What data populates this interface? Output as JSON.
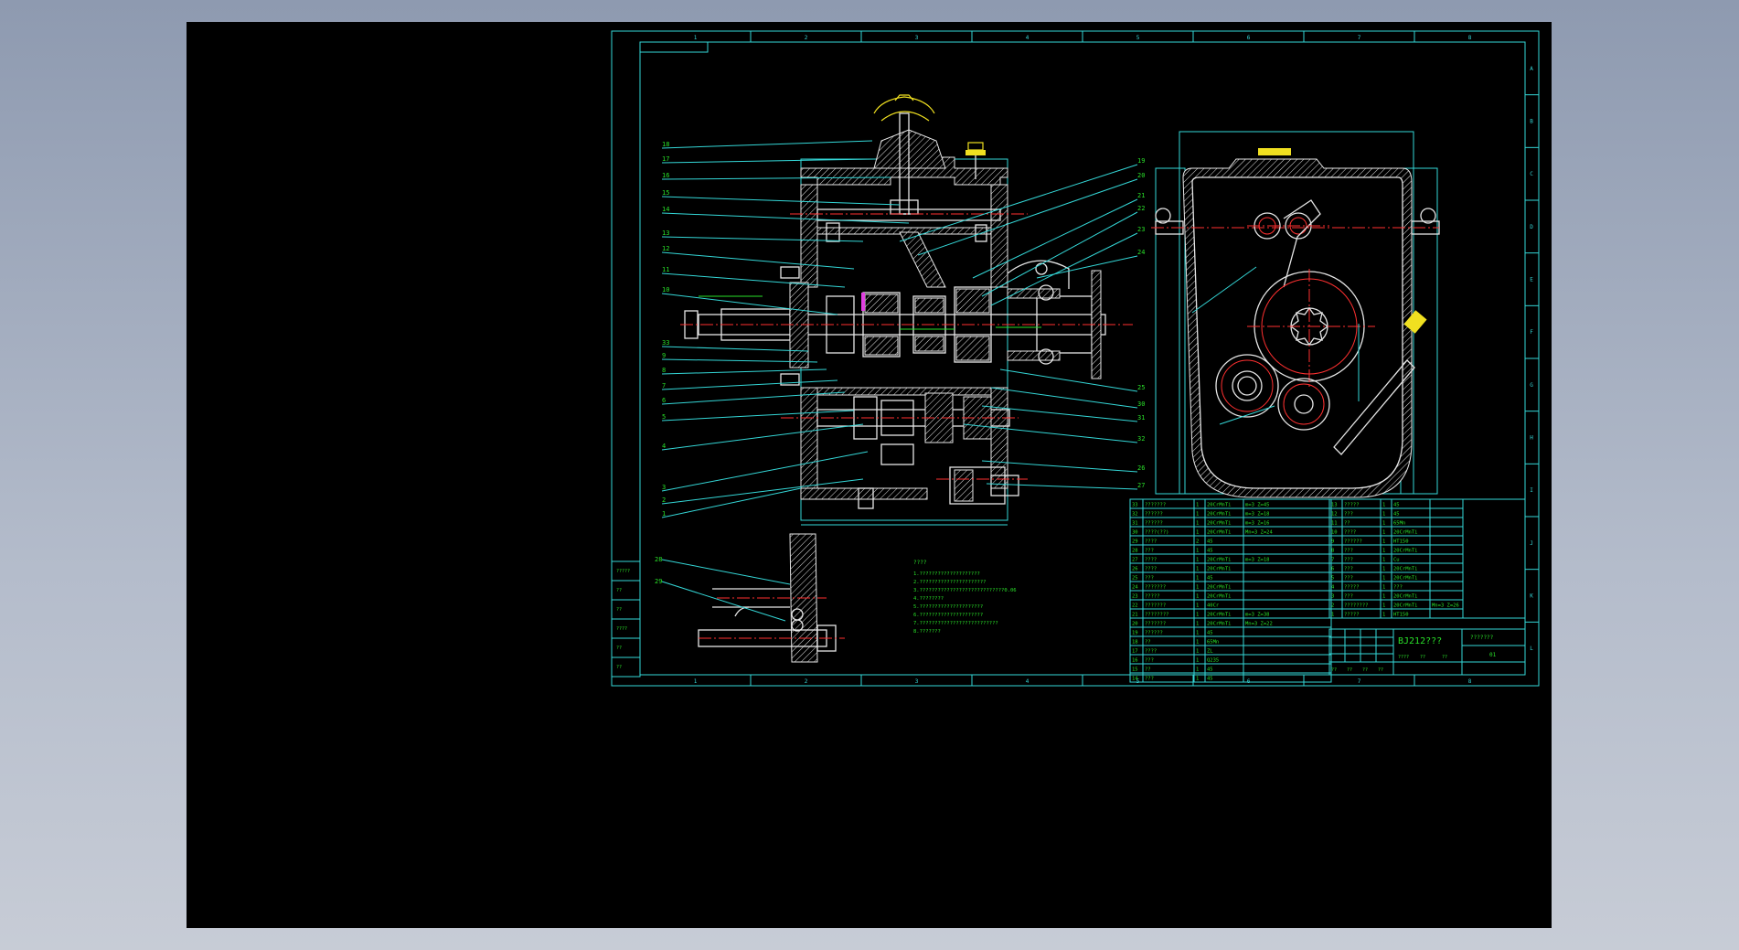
{
  "colors": {
    "background": "#000000",
    "border": "#34d7d7",
    "outline": "#e6e6e6",
    "text": "#29e029",
    "centerline": "#ff3030",
    "handle": "#f0e020"
  },
  "zone_columns": [
    "1",
    "2",
    "3",
    "4",
    "5",
    "6",
    "7",
    "8"
  ],
  "zone_rows": [
    "A",
    "B",
    "C",
    "D",
    "E",
    "F",
    "G",
    "H",
    "I",
    "J",
    "K",
    "L"
  ],
  "balloons_left": [
    "18",
    "17",
    "16",
    "15",
    "14",
    "13",
    "12",
    "11",
    "10",
    "33",
    "9",
    "8",
    "7",
    "6",
    "5",
    "4",
    "3",
    "2",
    "1"
  ],
  "balloons_right": [
    "19",
    "20",
    "21",
    "22",
    "23",
    "24",
    "25",
    "30",
    "31",
    "32",
    "26",
    "27"
  ],
  "detail_balloons": [
    "28",
    "29"
  ],
  "tech_requirements": {
    "heading": "????",
    "lines": [
      "1.????????????????????",
      "2.??????????????????????",
      "3.????????????????????????????0.06",
      "4.????????",
      "5.?????????????????????",
      "6.?????????????????????",
      "7.??????????????????????????",
      "8.???????"
    ]
  },
  "parts_left": [
    {
      "no": "33",
      "name": "???????",
      "qty": "1",
      "mat": "20CrMnTi",
      "note": "m=3 Z=45"
    },
    {
      "no": "32",
      "name": "??????",
      "qty": "1",
      "mat": "20CrMnTi",
      "note": "m=3 Z=18"
    },
    {
      "no": "31",
      "name": "??????",
      "qty": "1",
      "mat": "20CrMnTi",
      "note": "m=3 Z=16"
    },
    {
      "no": "30",
      "name": "????(??)",
      "qty": "1",
      "mat": "20CrMnTi",
      "note": "Mn=3 Z=24"
    },
    {
      "no": "29",
      "name": "????",
      "qty": "2",
      "mat": "45",
      "note": ""
    },
    {
      "no": "28",
      "name": "???",
      "qty": "1",
      "mat": "45",
      "note": ""
    },
    {
      "no": "27",
      "name": "????",
      "qty": "1",
      "mat": "20CrMnTi",
      "note": "m=3 Z=18"
    },
    {
      "no": "26",
      "name": "????",
      "qty": "1",
      "mat": "20CrMnTi",
      "note": ""
    },
    {
      "no": "25",
      "name": "???",
      "qty": "1",
      "mat": "45",
      "note": ""
    },
    {
      "no": "24",
      "name": "???????",
      "qty": "1",
      "mat": "20CrMnTi",
      "note": ""
    },
    {
      "no": "23",
      "name": "?????",
      "qty": "1",
      "mat": "20CrMnTi",
      "note": ""
    },
    {
      "no": "22",
      "name": "???????",
      "qty": "1",
      "mat": "40Cr",
      "note": ""
    },
    {
      "no": "21",
      "name": "????????",
      "qty": "1",
      "mat": "20CrMnTi",
      "note": "m=3 Z=38"
    },
    {
      "no": "20",
      "name": "???????",
      "qty": "1",
      "mat": "20CrMnTi",
      "note": "Mn=3 Z=22"
    },
    {
      "no": "19",
      "name": "??????",
      "qty": "1",
      "mat": "45",
      "note": ""
    },
    {
      "no": "18",
      "name": "??",
      "qty": "1",
      "mat": "65Mn",
      "note": ""
    },
    {
      "no": "17",
      "name": "????",
      "qty": "1",
      "mat": "ZL",
      "note": ""
    },
    {
      "no": "16",
      "name": "???",
      "qty": "1",
      "mat": "Q235",
      "note": ""
    },
    {
      "no": "15",
      "name": "??",
      "qty": "1",
      "mat": "45",
      "note": ""
    },
    {
      "no": "14",
      "name": "???",
      "qty": "1",
      "mat": "45",
      "note": ""
    }
  ],
  "parts_right": [
    {
      "no": "13",
      "name": "?????",
      "qty": "1",
      "mat": "45",
      "note": ""
    },
    {
      "no": "12",
      "name": "???",
      "qty": "1",
      "mat": "45",
      "note": ""
    },
    {
      "no": "11",
      "name": "??",
      "qty": "1",
      "mat": "65Mn",
      "note": ""
    },
    {
      "no": "10",
      "name": "????",
      "qty": "1",
      "mat": "20CrMnTi",
      "note": ""
    },
    {
      "no": "9",
      "name": "??????",
      "qty": "1",
      "mat": "HT150",
      "note": ""
    },
    {
      "no": "8",
      "name": "???",
      "qty": "1",
      "mat": "20CrMnTi",
      "note": ""
    },
    {
      "no": "7",
      "name": "???",
      "qty": "1",
      "mat": "Cu",
      "note": ""
    },
    {
      "no": "6",
      "name": "???",
      "qty": "1",
      "mat": "20CrMnTi",
      "note": ""
    },
    {
      "no": "5",
      "name": "???",
      "qty": "1",
      "mat": "20CrMnTi",
      "note": ""
    },
    {
      "no": "4",
      "name": "?????",
      "qty": "1",
      "mat": "???",
      "note": ""
    },
    {
      "no": "3",
      "name": "???",
      "qty": "1",
      "mat": "20CrMnTi",
      "note": ""
    },
    {
      "no": "2",
      "name": "????????",
      "qty": "1",
      "mat": "20CrMnTi",
      "note": "Mn=3 Z=26"
    },
    {
      "no": "1",
      "name": "?????",
      "qty": "1",
      "mat": "HT150",
      "note": ""
    }
  ],
  "title_block": {
    "drawing_name": "BJ212???",
    "school": "???????",
    "sheet_no": "01",
    "designer_cells": [
      "??",
      "??",
      "??",
      "??"
    ],
    "scale_cells": [
      "????",
      "??",
      "??"
    ]
  },
  "revision_block": [
    "?????",
    "??",
    "??",
    "????",
    "??",
    "??"
  ]
}
